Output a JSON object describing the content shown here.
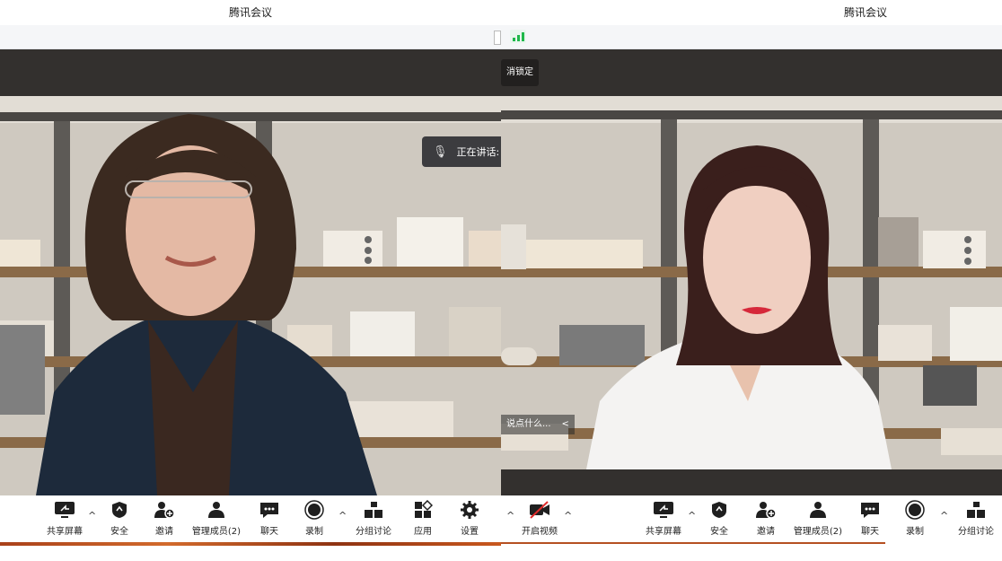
{
  "left": {
    "title": "腾讯会议",
    "speaking_label": "正在讲话:",
    "toolbar": [
      {
        "name": "share-screen-button",
        "label": "共享屏幕",
        "icon": "monitor-share-icon"
      },
      {
        "name": "security-button",
        "label": "安全",
        "icon": "shield-icon"
      },
      {
        "name": "invite-button",
        "label": "邀请",
        "icon": "add-person-icon"
      },
      {
        "name": "manage-members-button",
        "label": "管理成员(2)",
        "icon": "person-icon"
      },
      {
        "name": "chat-button",
        "label": "聊天",
        "icon": "chat-bubble-icon"
      },
      {
        "name": "record-button",
        "label": "录制",
        "icon": "record-icon"
      },
      {
        "name": "breakout-button",
        "label": "分组讨论",
        "icon": "breakout-icon"
      },
      {
        "name": "apps-button",
        "label": "应用",
        "icon": "apps-icon"
      },
      {
        "name": "settings-button",
        "label": "设置",
        "icon": "gear-icon"
      }
    ]
  },
  "right": {
    "title": "腾讯会议",
    "unlock_label": "消锁定",
    "chat_hint": "说点什么...",
    "toolbar": [
      {
        "name": "start-video-button",
        "label": "开启视频",
        "icon": "camera-off-icon"
      },
      {
        "name": "share-screen-button",
        "label": "共享屏幕",
        "icon": "monitor-share-icon"
      },
      {
        "name": "security-button",
        "label": "安全",
        "icon": "shield-icon"
      },
      {
        "name": "invite-button",
        "label": "邀请",
        "icon": "add-person-icon"
      },
      {
        "name": "manage-members-button",
        "label": "管理成员(2)",
        "icon": "person-icon"
      },
      {
        "name": "chat-button",
        "label": "聊天",
        "icon": "chat-bubble-icon"
      },
      {
        "name": "record-button",
        "label": "录制",
        "icon": "record-icon"
      },
      {
        "name": "breakout-button",
        "label": "分组讨论",
        "icon": "breakout-icon"
      }
    ]
  },
  "colors": {
    "dark_band": "#33302e",
    "signal_green": "#1fb84a",
    "toolbar_text": "#1f1f1f"
  }
}
